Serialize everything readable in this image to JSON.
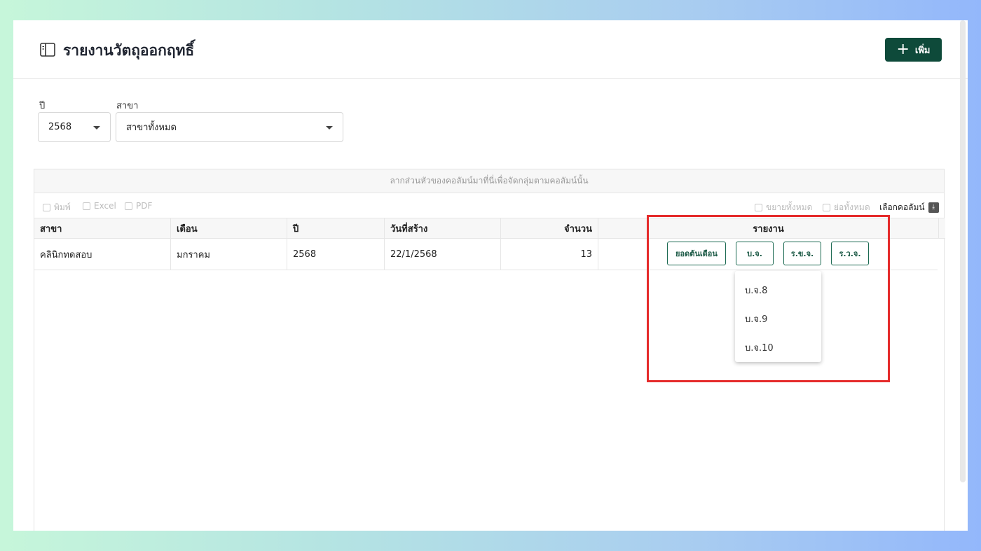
{
  "header": {
    "title": "รายงานวัตถุออกฤทธิ์",
    "add_label": "เพิ่ม"
  },
  "filters": {
    "year_label": "ปี",
    "year_value": "2568",
    "branch_label": "สาขา",
    "branch_value": "สาขาทั้งหมด"
  },
  "grid": {
    "group_hint": "ลากส่วนหัวของคอลัมน์มาที่นี่เพื่อจัดกลุ่มตามคอลัมน์นั้น",
    "toolbar": {
      "print": "พิมพ์",
      "excel": "Excel",
      "pdf": "PDF",
      "expand_all": "ขยายทั้งหมด",
      "collapse_all": "ย่อทั้งหมด",
      "choose_columns": "เลือกคอลัมน์"
    },
    "columns": [
      "สาขา",
      "เดือน",
      "ปี",
      "วันที่สร้าง",
      "จำนวน",
      "รายงาน"
    ],
    "rows": [
      [
        "คลินิกทดสอบ",
        "มกราคม",
        "2568",
        "22/1/2568",
        "13"
      ]
    ],
    "report_buttons": [
      "ยอดต้นเดือน",
      "บ.จ.",
      "ร.ข.จ.",
      "ร.ว.จ."
    ]
  },
  "dropdown": {
    "items": [
      "บ.จ.8",
      "บ.จ.9",
      "บ.จ.10"
    ]
  },
  "colors": {
    "primary": "#0e4a3a",
    "highlight": "#e52b2b"
  }
}
